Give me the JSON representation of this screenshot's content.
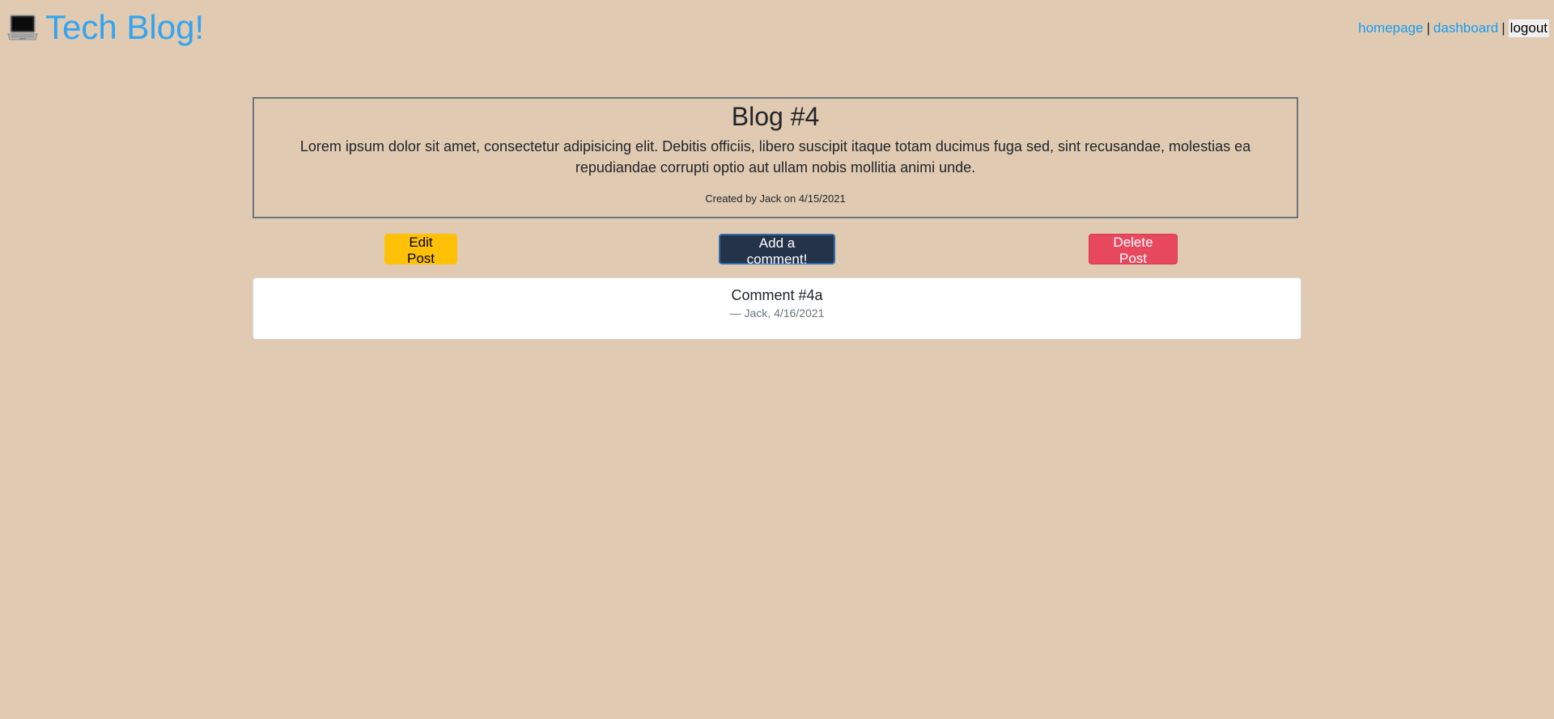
{
  "header": {
    "title": "Tech Blog!",
    "logo_icon": "laptop-icon",
    "nav": {
      "homepage": "homepage",
      "separator": "|",
      "dashboard": "dashboard",
      "logout": "logout"
    }
  },
  "post": {
    "title": "Blog #4",
    "body": "Lorem ipsum dolor sit amet, consectetur adipisicing elit. Debitis officiis, libero suscipit itaque totam ducimus fuga sed, sint recusandae, molestias ea repudiandae corrupti optio aut ullam nobis mollitia animi unde.",
    "meta": "Created by Jack on 4/15/2021"
  },
  "actions": {
    "edit": "Edit Post",
    "comment": "Add a comment!",
    "delete": "Delete Post"
  },
  "comments": [
    {
      "text": "Comment #4a",
      "meta": "— Jack, 4/16/2021"
    }
  ],
  "colors": {
    "background": "#e0cab2",
    "brand": "#32a4f0",
    "edit": "#ffc107",
    "comment": "#243348",
    "delete": "#e8485e"
  }
}
